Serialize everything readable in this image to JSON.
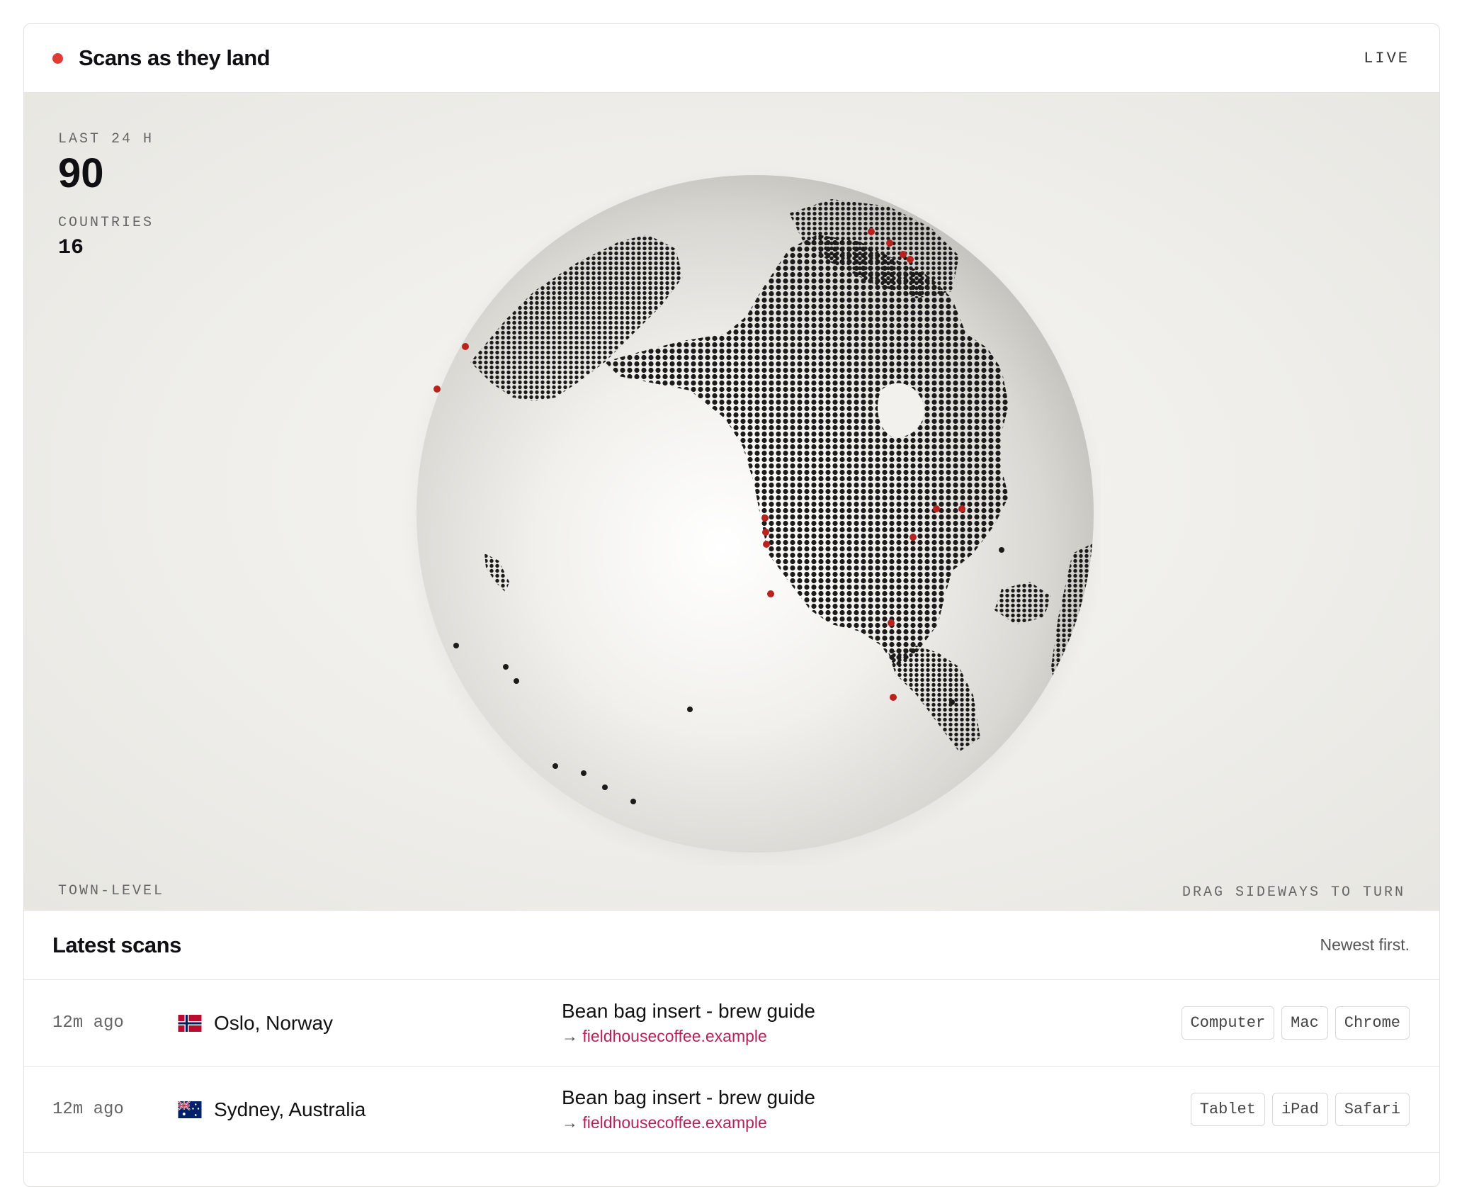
{
  "header": {
    "title": "Scans as they land",
    "status": "LIVE",
    "accent_color": "#e23b35"
  },
  "stats": {
    "period_label": "LAST 24 H",
    "total_scans": "90",
    "countries_label": "COUNTRIES",
    "countries": "16"
  },
  "globe": {
    "precision_label": "TOWN-LEVEL",
    "hint": "DRAG SIDEWAYS TO TURN",
    "land_color": "#1c1a1a",
    "marker_color": "#b8231f"
  },
  "list": {
    "title": "Latest scans",
    "subtitle": "Newest first.",
    "rows": [
      {
        "time": "12m ago",
        "flag_icon": "norway-flag-icon",
        "location": "Oslo, Norway",
        "page": "Bean bag insert - brew guide",
        "arrow": "→",
        "domain": "fieldhousecoffee.example",
        "tags": [
          "Computer",
          "Mac",
          "Chrome"
        ]
      },
      {
        "time": "12m ago",
        "flag_icon": "australia-flag-icon",
        "location": "Sydney, Australia",
        "page": "Bean bag insert - brew guide",
        "arrow": "→",
        "domain": "fieldhousecoffee.example",
        "tags": [
          "Tablet",
          "iPad",
          "Safari"
        ]
      }
    ]
  }
}
